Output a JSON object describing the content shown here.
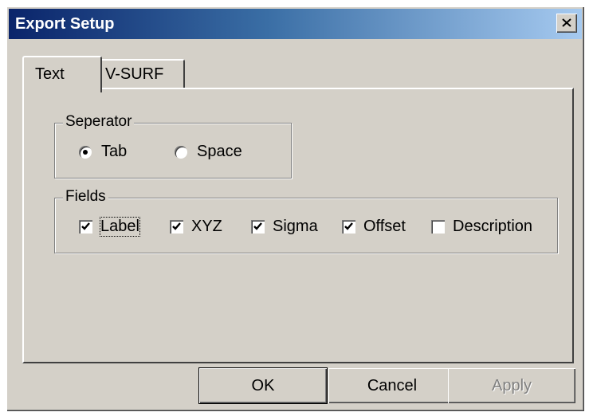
{
  "window": {
    "title": "Export Setup"
  },
  "tabs": [
    {
      "label": "Text",
      "active": true
    },
    {
      "label": "V-SURF",
      "active": false
    }
  ],
  "separator": {
    "title": "Seperator",
    "options": [
      {
        "label": "Tab",
        "selected": true
      },
      {
        "label": "Space",
        "selected": false
      }
    ]
  },
  "fields": {
    "title": "Fields",
    "items": [
      {
        "label": "Label",
        "checked": true
      },
      {
        "label": "XYZ",
        "checked": true
      },
      {
        "label": "Sigma",
        "checked": true
      },
      {
        "label": "Offset",
        "checked": true
      },
      {
        "label": "Description",
        "checked": false
      }
    ]
  },
  "buttons": {
    "ok": "OK",
    "cancel": "Cancel",
    "apply": "Apply"
  },
  "colors": {
    "title_bar_start": "#0a246a",
    "title_bar_end": "#a6caf0",
    "dialog_face": "#d4d0c8"
  }
}
